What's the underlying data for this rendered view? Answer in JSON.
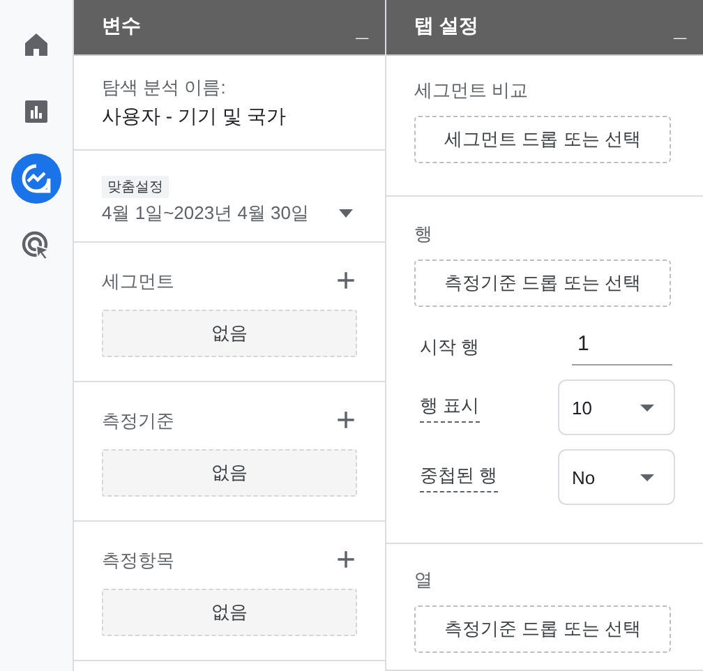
{
  "nav": [
    {
      "kind": "home",
      "selected": false
    },
    {
      "kind": "reports",
      "selected": false
    },
    {
      "kind": "explore",
      "selected": true
    },
    {
      "kind": "advertising",
      "selected": false
    }
  ],
  "variables": {
    "title": "변수",
    "collapse": "_",
    "name_label": "탐색 분석 이름:",
    "name_value": "사용자 - 기기 및 국가",
    "date_tag": "맞춤설정",
    "date_range": "4월 1일~2023년 4월 30일",
    "sections": [
      {
        "title": "세그먼트",
        "plus": "+",
        "empty": "없음"
      },
      {
        "title": "측정기준",
        "plus": "+",
        "empty": "없음"
      },
      {
        "title": "측정항목",
        "plus": "+",
        "empty": "없음"
      }
    ]
  },
  "tab_settings": {
    "title": "탭 설정",
    "collapse": "_",
    "compare": {
      "label": "세그먼트 비교",
      "drop": "세그먼트 드롭 또는 선택"
    },
    "rows": {
      "label": "행",
      "drop": "측정기준 드롭 또는 선택",
      "start_label": "시작 행",
      "start_value": "1",
      "show_label": "행 표시",
      "show_value": "10",
      "nested_label": "중첩된 행",
      "nested_value": "No"
    },
    "columns": {
      "label": "열",
      "drop": "측정기준 드롭 또는 선택"
    }
  }
}
